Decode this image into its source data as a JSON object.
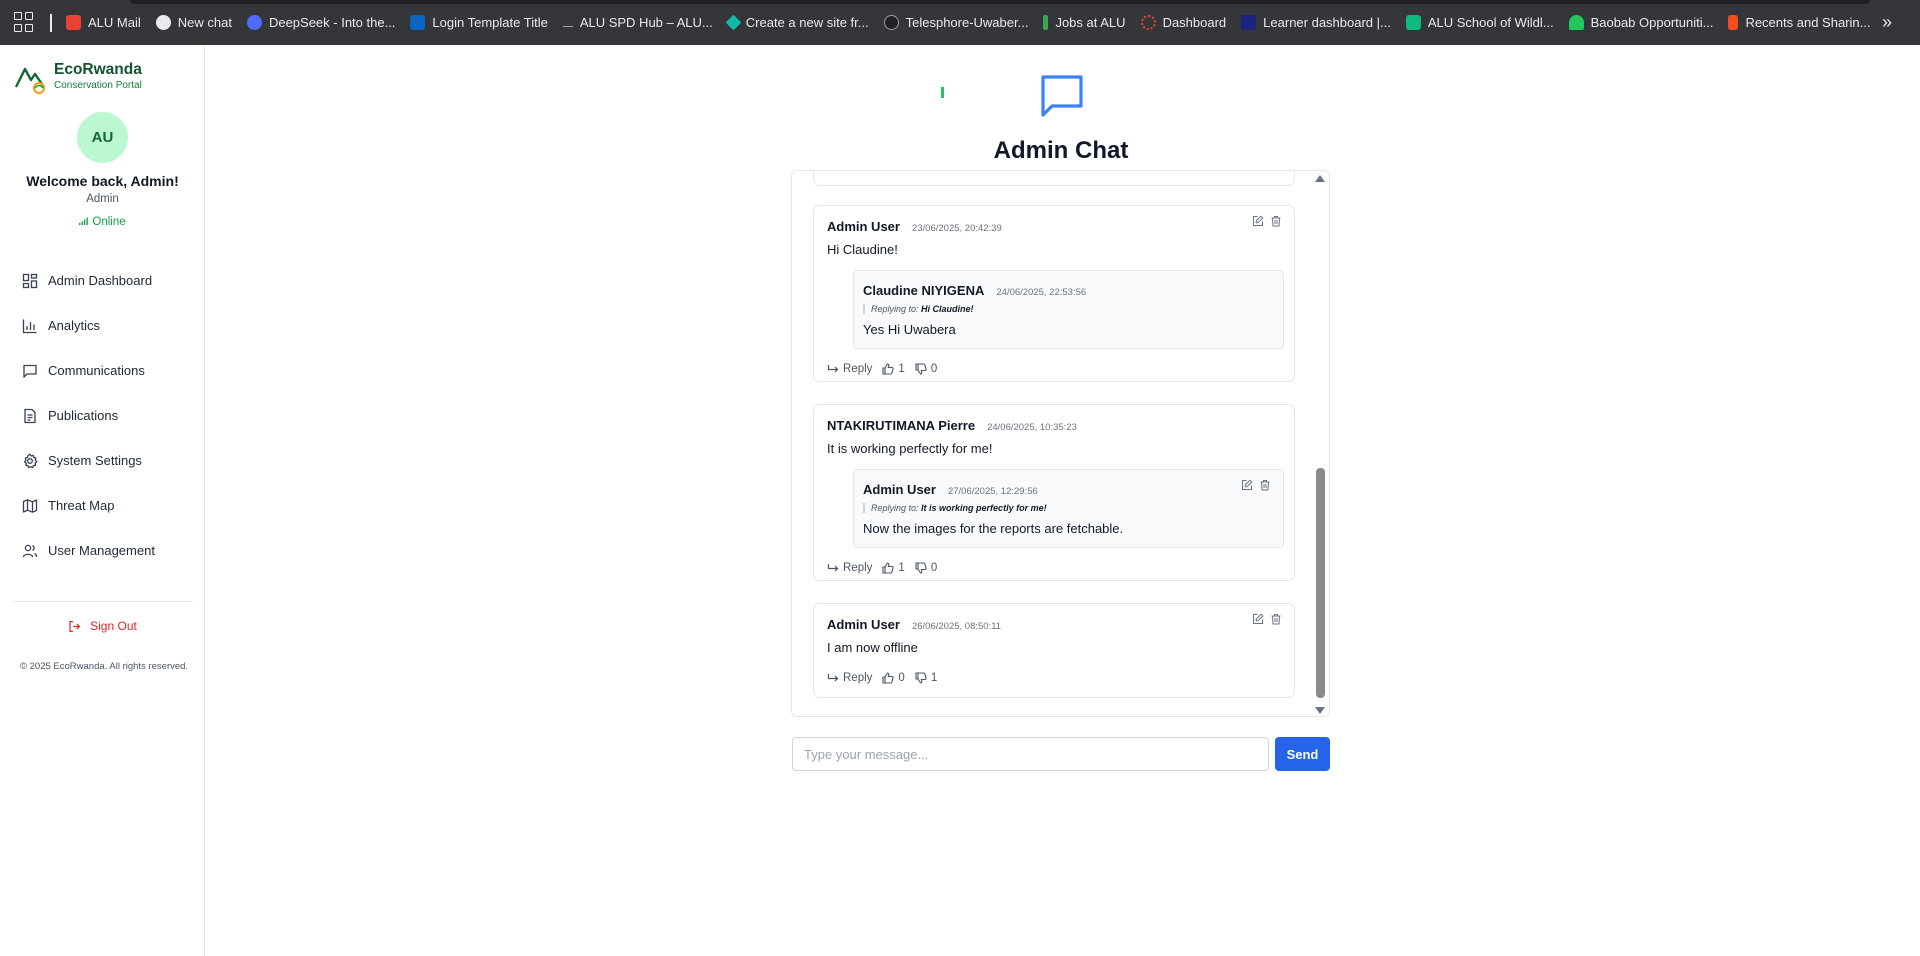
{
  "bookmarks": [
    {
      "label": "ALU Mail",
      "color": "#ea4335"
    },
    {
      "label": "New chat",
      "color": "#e8eaed"
    },
    {
      "label": "DeepSeek - Into the...",
      "color": "#4d6bfe"
    },
    {
      "label": "Login Template Title",
      "color": "#0a66c2"
    },
    {
      "label": "ALU SPD Hub – ALU...",
      "color": "#9aa0a6"
    },
    {
      "label": "Create a new site fr...",
      "color": "#14b8a6"
    },
    {
      "label": "Telesphore-Uwaber...",
      "color": "#9aa0a6"
    },
    {
      "label": "Jobs at ALU",
      "color": "#34a853"
    },
    {
      "label": "Dashboard",
      "color": "#ea4335"
    },
    {
      "label": "Learner dashboard |...",
      "color": "#1a237e"
    },
    {
      "label": "ALU School of Wildl...",
      "color": "#10b981"
    },
    {
      "label": "Baobab Opportuniti...",
      "color": "#22c55e"
    },
    {
      "label": "Recents and Sharin...",
      "color": "#f24e1e"
    }
  ],
  "sidebar": {
    "brand": {
      "name": "EcoRwanda",
      "subtitle": "Conservation Portal"
    },
    "avatar_initials": "AU",
    "welcome": "Welcome back, Admin!",
    "role": "Admin",
    "status": "Online",
    "nav": [
      {
        "label": "Admin Dashboard",
        "icon": "grid-icon"
      },
      {
        "label": "Analytics",
        "icon": "bar-chart-icon"
      },
      {
        "label": "Communications",
        "icon": "message-icon"
      },
      {
        "label": "Publications",
        "icon": "document-icon"
      },
      {
        "label": "System Settings",
        "icon": "gear-icon"
      },
      {
        "label": "Threat Map",
        "icon": "map-icon"
      },
      {
        "label": "User Management",
        "icon": "users-icon"
      }
    ],
    "sign_out": "Sign Out",
    "copyright": "© 2025 EcoRwanda. All rights reserved."
  },
  "header": {
    "title": "Admin Chat"
  },
  "messages": [
    {
      "author": "Admin User",
      "timestamp": "23/06/2025, 20:42:39",
      "text": "Hi Claudine!",
      "reply": {
        "author": "Claudine NIYIGENA",
        "timestamp": "24/06/2025, 22:53:56",
        "replying_label": "Replying to:",
        "replying_to": "Hi Claudine!",
        "text": "Yes Hi Uwabera"
      },
      "reply_label": "Reply",
      "likes": "1",
      "dislikes": "0"
    },
    {
      "author": "NTAKIRUTIMANA Pierre",
      "timestamp": "24/06/2025, 10:35:23",
      "text": "It is working perfectly for me!",
      "reply": {
        "author": "Admin User",
        "timestamp": "27/06/2025, 12:29:56",
        "replying_label": "Replying to:",
        "replying_to": "It is working perfectly for me!",
        "text": "Now the images for the reports are fetchable."
      },
      "reply_label": "Reply",
      "likes": "1",
      "dislikes": "0"
    },
    {
      "author": "Admin User",
      "timestamp": "26/06/2025, 08:50:11",
      "text": "I am now offline",
      "reply_label": "Reply",
      "likes": "0",
      "dislikes": "1"
    }
  ],
  "composer": {
    "placeholder": "Type your message...",
    "send_label": "Send"
  },
  "colors": {
    "brand_green": "#14532d",
    "accent_blue": "#2563eb",
    "sign_out_red": "#dc2626",
    "online_green": "#16a34a"
  }
}
